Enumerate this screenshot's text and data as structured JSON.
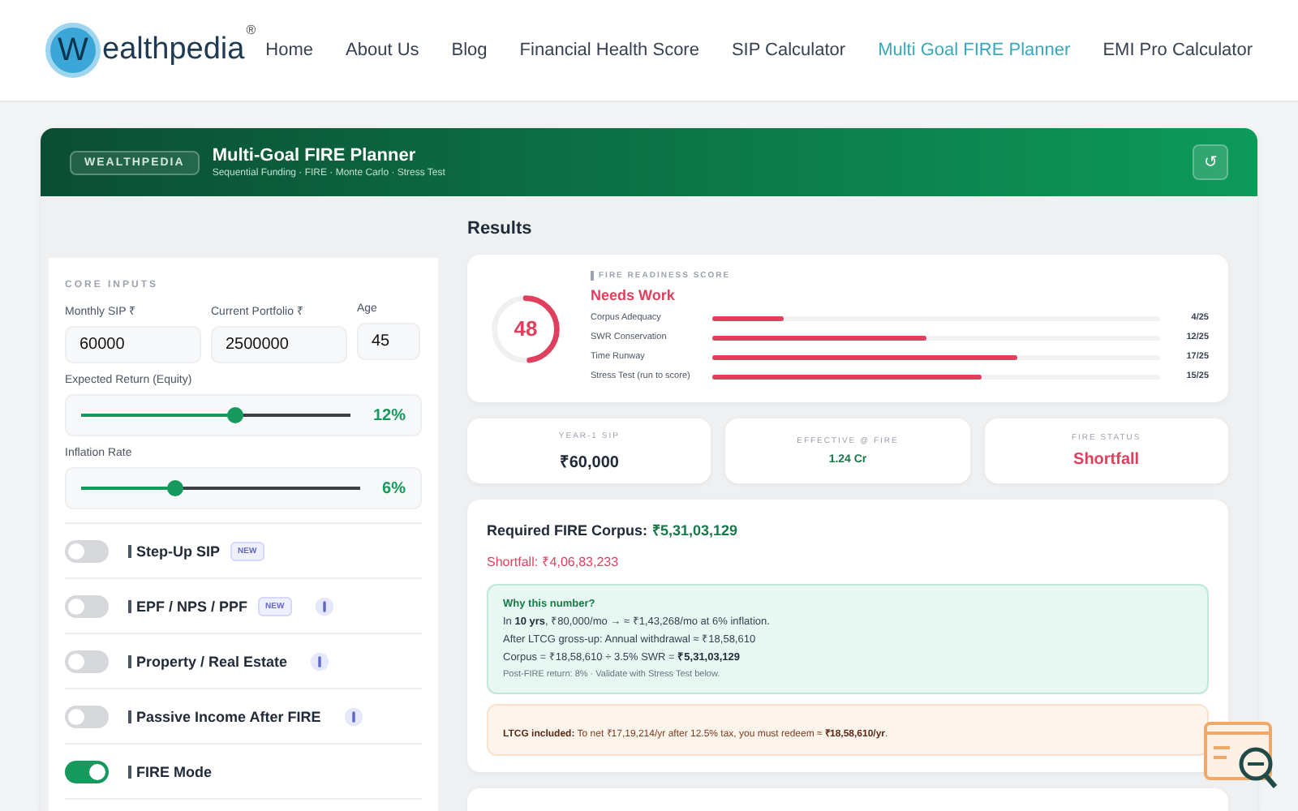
{
  "logo": {
    "mark": "W",
    "text": "ealthpedia",
    "reg": "®"
  },
  "nav": [
    {
      "label": "Home",
      "selected": false
    },
    {
      "label": "About Us",
      "selected": false
    },
    {
      "label": "Blog",
      "selected": false
    },
    {
      "label": "Financial Health Score",
      "selected": false
    },
    {
      "label": "SIP Calculator",
      "selected": false
    },
    {
      "label": "Multi Goal FIRE Planner",
      "selected": true
    },
    {
      "label": "EMI Pro Calculator",
      "selected": false
    }
  ],
  "banner": {
    "badge": "WEALTHPEDIA",
    "title": "Multi-Goal FIRE Planner",
    "subtitle": "Sequential Funding · FIRE · Monte Carlo · Stress Test",
    "reset": "↺"
  },
  "inputs": {
    "heading": "CORE INPUTS",
    "fields": [
      {
        "label": "Monthly SIP ₹",
        "value": "60000"
      },
      {
        "label": "Current Portfolio ₹",
        "value": "2500000"
      },
      {
        "label": "Age",
        "value": "45"
      }
    ],
    "sliders": [
      {
        "label": "Expected Return (Equity)",
        "level": 0.57,
        "reading": "12%"
      },
      {
        "label": "Inflation Rate",
        "level": 0.34,
        "reading": "6%"
      }
    ],
    "toggles": [
      {
        "label": "Step-Up SIP",
        "on": false,
        "tag": "NEW",
        "info": false
      },
      {
        "label": "EPF / NPS / PPF",
        "on": false,
        "tag": "NEW",
        "info": true
      },
      {
        "label": "Property / Real Estate",
        "on": false,
        "info": true
      },
      {
        "label": "Passive Income After FIRE",
        "on": false,
        "info": true
      },
      {
        "label": "FIRE Mode",
        "on": true,
        "info": false
      }
    ]
  },
  "results": {
    "heading": "Results",
    "score": {
      "value": "48",
      "level": 0.48,
      "caption": "FIRE READINESS SCORE",
      "verdict": "Needs Work",
      "bars": [
        {
          "label": "Corpus Adequacy",
          "level": 0.16,
          "reading": "4/25"
        },
        {
          "label": "SWR Conservation",
          "level": 0.48,
          "reading": "12/25"
        },
        {
          "label": "Time Runway",
          "level": 0.68,
          "reading": "17/25"
        },
        {
          "label": "Stress Test (run to score)",
          "level": 0.6,
          "reading": "15/25"
        }
      ]
    },
    "stats": [
      {
        "label": "YEAR-1 SIP",
        "value": "₹60,000",
        "kind": "plain"
      },
      {
        "label": "EFFECTIVE @ FIRE",
        "value": "1.24 Cr",
        "kind": "good"
      },
      {
        "label": "FIRE STATUS",
        "value": "Shortfall",
        "kind": "bad"
      }
    ],
    "corpus": {
      "label": "Required FIRE Corpus:",
      "value": "₹5,31,03,129",
      "shortfall": "Shortfall: ₹4,06,83,233",
      "why": {
        "title": "Why this number?",
        "lines": [
          "In **10 yrs**, ₹80,000/mo → ≈ ₹1,43,268/mo at 6% inflation.",
          "After LTCG gross-up: Annual withdrawal ≈ ₹18,58,610",
          "Corpus = ₹18,58,610 ÷ 3.5% SWR = **₹5,31,03,129**"
        ],
        "note": "Post-FIRE return: 8% · Validate with Stress Test below."
      },
      "ltcg": "**LTCG included:** To net ₹17,19,214/yr after 12.5% tax, you must redeem ≈ **₹18,58,610/yr**."
    }
  }
}
